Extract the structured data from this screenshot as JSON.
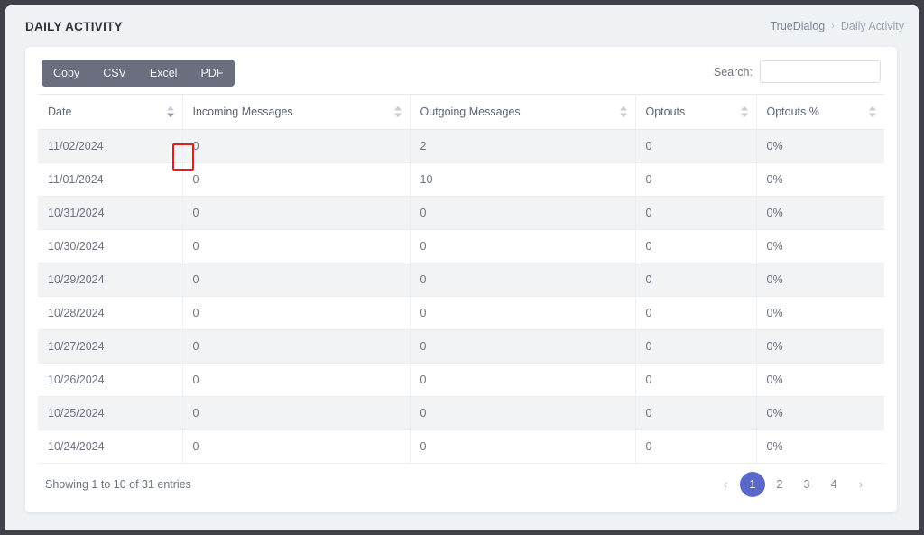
{
  "header": {
    "title": "DAILY ACTIVITY",
    "breadcrumb": {
      "root": "TrueDialog",
      "separator": "›",
      "current": "Daily Activity"
    }
  },
  "toolbar": {
    "export_buttons": [
      {
        "label": "Copy",
        "name": "copy-button"
      },
      {
        "label": "CSV",
        "name": "csv-button"
      },
      {
        "label": "Excel",
        "name": "excel-button"
      },
      {
        "label": "PDF",
        "name": "pdf-button"
      }
    ],
    "search": {
      "label": "Search:",
      "value": "",
      "placeholder": ""
    }
  },
  "table": {
    "columns": [
      {
        "label": "Date",
        "sortable": true,
        "sorted": "desc",
        "highlighted": true
      },
      {
        "label": "Incoming Messages",
        "sortable": true,
        "sorted": "none",
        "highlighted": false
      },
      {
        "label": "Outgoing Messages",
        "sortable": true,
        "sorted": "none",
        "highlighted": false
      },
      {
        "label": "Optouts",
        "sortable": true,
        "sorted": "none",
        "highlighted": false
      },
      {
        "label": "Optouts %",
        "sortable": true,
        "sorted": "none",
        "highlighted": false
      }
    ],
    "rows": [
      {
        "date": "11/02/2024",
        "incoming": "0",
        "outgoing": "2",
        "optouts": "0",
        "optouts_pct": "0%"
      },
      {
        "date": "11/01/2024",
        "incoming": "0",
        "outgoing": "10",
        "optouts": "0",
        "optouts_pct": "0%"
      },
      {
        "date": "10/31/2024",
        "incoming": "0",
        "outgoing": "0",
        "optouts": "0",
        "optouts_pct": "0%"
      },
      {
        "date": "10/30/2024",
        "incoming": "0",
        "outgoing": "0",
        "optouts": "0",
        "optouts_pct": "0%"
      },
      {
        "date": "10/29/2024",
        "incoming": "0",
        "outgoing": "0",
        "optouts": "0",
        "optouts_pct": "0%"
      },
      {
        "date": "10/28/2024",
        "incoming": "0",
        "outgoing": "0",
        "optouts": "0",
        "optouts_pct": "0%"
      },
      {
        "date": "10/27/2024",
        "incoming": "0",
        "outgoing": "0",
        "optouts": "0",
        "optouts_pct": "0%"
      },
      {
        "date": "10/26/2024",
        "incoming": "0",
        "outgoing": "0",
        "optouts": "0",
        "optouts_pct": "0%"
      },
      {
        "date": "10/25/2024",
        "incoming": "0",
        "outgoing": "0",
        "optouts": "0",
        "optouts_pct": "0%"
      },
      {
        "date": "10/24/2024",
        "incoming": "0",
        "outgoing": "0",
        "optouts": "0",
        "optouts_pct": "0%"
      }
    ]
  },
  "footer": {
    "showing_info": "Showing 1 to 10 of 31 entries",
    "pagination": {
      "previous": "‹",
      "next": "›",
      "pages": [
        "1",
        "2",
        "3",
        "4"
      ],
      "active_page": "1"
    }
  },
  "colors": {
    "accent": "#5b68ca",
    "toolbar_bg": "#6a6e7e",
    "highlight_box": "#e81b1b",
    "page_bg": "#eef2f5",
    "card_bg": "#ffffff",
    "row_alt_bg": "#f2f3f5"
  }
}
